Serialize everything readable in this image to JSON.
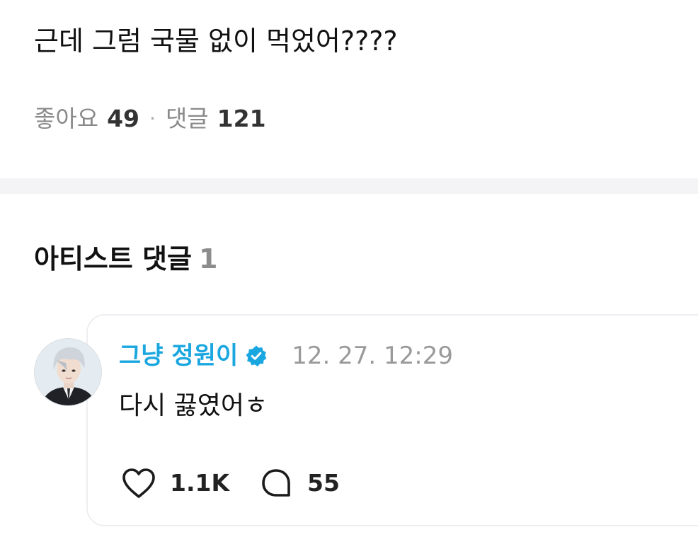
{
  "post": {
    "text": "근데 그럼 국물 없이 먹었어????",
    "likes_label": "좋아요",
    "likes_count": "49",
    "separator": "·",
    "comments_label": "댓글",
    "comments_count": "121"
  },
  "artist_comments": {
    "title": "아티스트 댓글",
    "count": "1",
    "items": [
      {
        "author": "그냥 정원이",
        "verified_icon": "verified-badge-icon",
        "timestamp": "12. 27. 12:29",
        "text": "다시 끓였어ㅎ",
        "likes": "1.1K",
        "replies": "55"
      }
    ]
  },
  "colors": {
    "author": "#1aa7e0",
    "muted": "#8a8a8a",
    "divider": "#f4f4f6"
  }
}
